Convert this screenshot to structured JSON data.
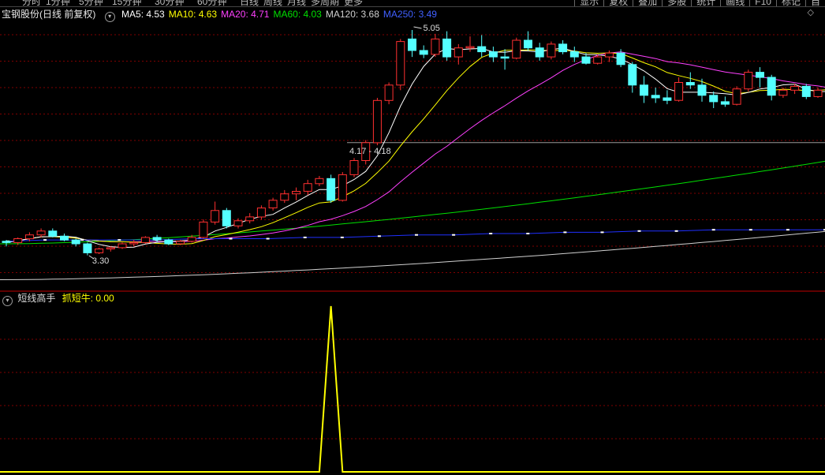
{
  "top_menu": [
    "分时",
    "1分钟",
    "5分钟",
    "15分钟",
    "30分钟",
    "60分钟",
    "日线",
    "周线",
    "月线",
    "多周期",
    "更多"
  ],
  "right_buttons": [
    "显示",
    "复权",
    "叠加",
    "多股",
    "统计",
    "画线",
    "F10",
    "标记",
    "自"
  ],
  "info": {
    "stock": "宝钢股份(日线 前复权)",
    "ma": [
      {
        "label": "MA5: 4.53",
        "color": "#ffffff"
      },
      {
        "label": "MA10: 4.63",
        "color": "#ffff00"
      },
      {
        "label": "MA20: 4.71",
        "color": "#ff40ff"
      },
      {
        "label": "MA60: 4.03",
        "color": "#00e000"
      },
      {
        "label": "MA120: 3.68",
        "color": "#d0d0d0"
      },
      {
        "label": "MA250: 3.49",
        "color": "#4060ff"
      }
    ]
  },
  "indicator": {
    "name": "短线高手",
    "value_label": "抓短牛: 0.00",
    "series": [
      0,
      0,
      0,
      0,
      0,
      0,
      0,
      0,
      0,
      0,
      0,
      0,
      0,
      0,
      0,
      0,
      0,
      0,
      0,
      0,
      0,
      0,
      0,
      0,
      0,
      0,
      0,
      0,
      1,
      0,
      0,
      0,
      0,
      0,
      0,
      0,
      0,
      0,
      0,
      0,
      0,
      0,
      0,
      0,
      0,
      0,
      0,
      0,
      0,
      0,
      0,
      0,
      0,
      0,
      0,
      0,
      0,
      0,
      0,
      0,
      0,
      0,
      0,
      0,
      0,
      0,
      0,
      0,
      0,
      0,
      0,
      0,
      0
    ]
  },
  "chart_data": {
    "type": "candlestick",
    "title": "宝钢股份(日线 前复权)",
    "annotations": [
      {
        "text": "5.05",
        "kind": "high"
      },
      {
        "text": "3.30",
        "kind": "low"
      },
      {
        "text": "4.17 - 4.18",
        "kind": "price-line"
      }
    ],
    "horizontal_line": 4.17,
    "candles": [
      [
        3.4,
        3.41,
        3.36,
        3.39
      ],
      [
        3.39,
        3.43,
        3.37,
        3.42
      ],
      [
        3.42,
        3.47,
        3.4,
        3.45
      ],
      [
        3.45,
        3.5,
        3.43,
        3.48
      ],
      [
        3.48,
        3.5,
        3.43,
        3.44
      ],
      [
        3.44,
        3.46,
        3.4,
        3.41
      ],
      [
        3.41,
        3.42,
        3.36,
        3.38
      ],
      [
        3.38,
        3.39,
        3.29,
        3.31
      ],
      [
        3.31,
        3.35,
        3.3,
        3.34
      ],
      [
        3.34,
        3.36,
        3.32,
        3.35
      ],
      [
        3.35,
        3.39,
        3.34,
        3.38
      ],
      [
        3.38,
        3.41,
        3.36,
        3.39
      ],
      [
        3.39,
        3.44,
        3.38,
        3.43
      ],
      [
        3.43,
        3.45,
        3.39,
        3.41
      ],
      [
        3.41,
        3.42,
        3.37,
        3.38
      ],
      [
        3.38,
        3.41,
        3.37,
        3.4
      ],
      [
        3.4,
        3.45,
        3.39,
        3.43
      ],
      [
        3.43,
        3.57,
        3.42,
        3.55
      ],
      [
        3.55,
        3.71,
        3.53,
        3.64
      ],
      [
        3.64,
        3.66,
        3.5,
        3.52
      ],
      [
        3.52,
        3.58,
        3.5,
        3.56
      ],
      [
        3.56,
        3.62,
        3.54,
        3.59
      ],
      [
        3.59,
        3.68,
        3.57,
        3.66
      ],
      [
        3.66,
        3.74,
        3.64,
        3.72
      ],
      [
        3.72,
        3.8,
        3.7,
        3.77
      ],
      [
        3.77,
        3.82,
        3.72,
        3.79
      ],
      [
        3.79,
        3.88,
        3.76,
        3.85
      ],
      [
        3.85,
        3.91,
        3.83,
        3.89
      ],
      [
        3.89,
        3.92,
        3.7,
        3.72
      ],
      [
        3.72,
        3.94,
        3.71,
        3.92
      ],
      [
        3.92,
        4.05,
        3.9,
        4.03
      ],
      [
        4.03,
        4.19,
        4.0,
        4.17
      ],
      [
        4.17,
        4.52,
        4.15,
        4.5
      ],
      [
        4.5,
        4.64,
        4.47,
        4.62
      ],
      [
        4.62,
        4.98,
        4.58,
        4.96
      ],
      [
        4.98,
        5.05,
        4.84,
        4.89
      ],
      [
        4.89,
        4.93,
        4.83,
        4.86
      ],
      [
        4.86,
        5.02,
        4.84,
        4.98
      ],
      [
        4.98,
        5.04,
        4.81,
        4.84
      ],
      [
        4.84,
        4.94,
        4.78,
        4.91
      ],
      [
        4.91,
        5.0,
        4.88,
        4.92
      ],
      [
        4.92,
        5.01,
        4.84,
        4.88
      ],
      [
        4.88,
        4.92,
        4.8,
        4.84
      ],
      [
        4.84,
        4.9,
        4.74,
        4.83
      ],
      [
        4.83,
        4.99,
        4.82,
        4.97
      ],
      [
        4.97,
        5.04,
        4.89,
        4.91
      ],
      [
        4.91,
        4.95,
        4.81,
        4.84
      ],
      [
        4.84,
        4.96,
        4.82,
        4.94
      ],
      [
        4.94,
        4.97,
        4.86,
        4.88
      ],
      [
        4.88,
        4.92,
        4.8,
        4.84
      ],
      [
        4.84,
        4.87,
        4.78,
        4.79
      ],
      [
        4.79,
        4.86,
        4.78,
        4.84
      ],
      [
        4.84,
        4.89,
        4.8,
        4.87
      ],
      [
        4.87,
        4.9,
        4.76,
        4.78
      ],
      [
        4.78,
        4.8,
        4.56,
        4.62
      ],
      [
        4.62,
        4.69,
        4.48,
        4.54
      ],
      [
        4.54,
        4.6,
        4.48,
        4.52
      ],
      [
        4.52,
        4.58,
        4.47,
        4.5
      ],
      [
        4.5,
        4.68,
        4.49,
        4.64
      ],
      [
        4.64,
        4.72,
        4.59,
        4.62
      ],
      [
        4.62,
        4.67,
        4.49,
        4.54
      ],
      [
        4.54,
        4.57,
        4.44,
        4.49
      ],
      [
        4.49,
        4.53,
        4.45,
        4.47
      ],
      [
        4.47,
        4.61,
        4.46,
        4.59
      ],
      [
        4.59,
        4.74,
        4.57,
        4.72
      ],
      [
        4.72,
        4.76,
        4.6,
        4.68
      ],
      [
        4.68,
        4.7,
        4.5,
        4.54
      ],
      [
        4.54,
        4.6,
        4.52,
        4.58
      ],
      [
        4.58,
        4.63,
        4.55,
        4.61
      ],
      [
        4.61,
        4.63,
        4.51,
        4.53
      ],
      [
        4.53,
        4.6,
        4.52,
        4.58
      ],
      [
        4.58,
        4.62,
        4.54,
        4.55
      ]
    ],
    "moving_averages": [
      "MA5",
      "MA10",
      "MA20",
      "MA60",
      "MA120",
      "MA250"
    ],
    "ma250_points": [
      3.4,
      3.41,
      3.41,
      3.41,
      3.41,
      3.42,
      3.42,
      3.42,
      3.43,
      3.43,
      3.44,
      3.45,
      3.45,
      3.46,
      3.46,
      3.47,
      3.47,
      3.48,
      3.48,
      3.49,
      3.49,
      3.49,
      3.49
    ],
    "ma120": [
      3.1,
      3.48
    ],
    "ma60": [
      3.38,
      4.03
    ]
  },
  "colors": {
    "up": "#ff3030",
    "down": "#54ffff",
    "grid": "#800000"
  }
}
